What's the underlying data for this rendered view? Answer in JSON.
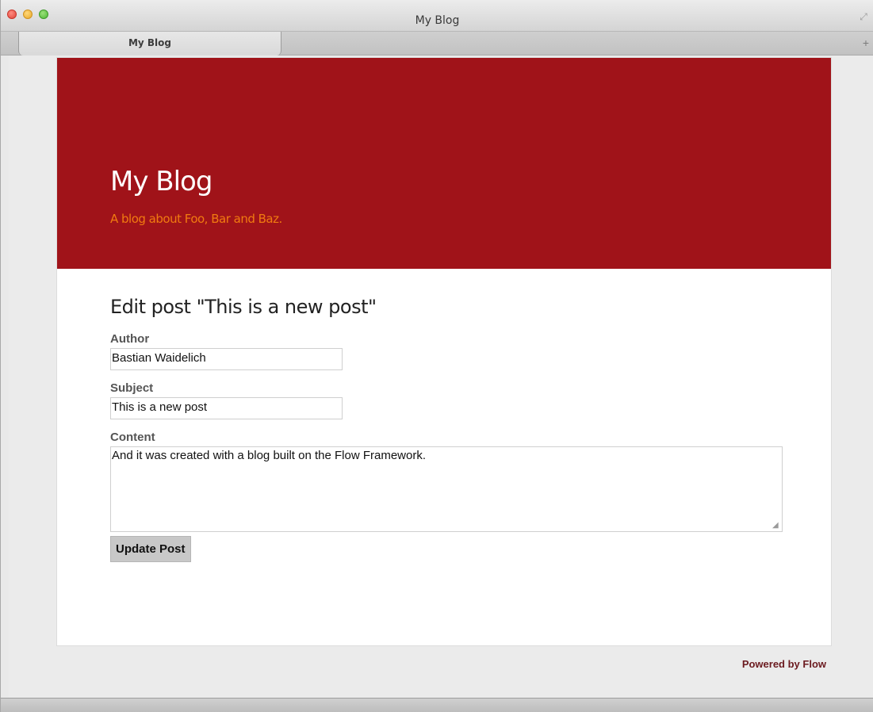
{
  "window": {
    "title": "My Blog"
  },
  "tabs": [
    {
      "label": "My Blog"
    }
  ],
  "tabbar": {
    "new_tab_icon": "+"
  },
  "header": {
    "title": "My Blog",
    "subtitle": "A blog about Foo, Bar and Baz.",
    "background_color": "#a01319",
    "subtitle_color": "#f07a10"
  },
  "form": {
    "heading": "Edit post \"This is a new post\"",
    "author": {
      "label": "Author",
      "value": "Bastian Waidelich"
    },
    "subject": {
      "label": "Subject",
      "value": "This is a new post"
    },
    "content": {
      "label": "Content",
      "value": "And it was created with a blog built on the Flow Framework."
    },
    "submit_label": "Update Post"
  },
  "footer": {
    "text": "Powered by Flow"
  },
  "icons": {
    "close": "traffic-light-close-icon",
    "minimize": "traffic-light-minimize-icon",
    "maximize": "traffic-light-maximize-icon",
    "fullscreen": "fullscreen-icon",
    "new_tab": "plus-icon"
  }
}
